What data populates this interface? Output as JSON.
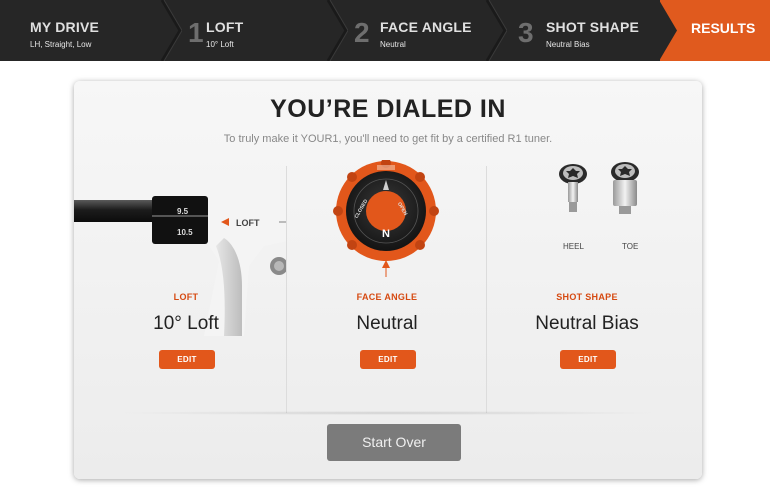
{
  "stepper": {
    "steps": [
      {
        "number": "",
        "title": "MY DRIVE",
        "sub": "LH, Straight, Low"
      },
      {
        "number": "1",
        "title": "LOFT",
        "sub": "10° Loft"
      },
      {
        "number": "2",
        "title": "FACE ANGLE",
        "sub": "Neutral"
      },
      {
        "number": "3",
        "title": "SHOT SHAPE",
        "sub": "Neutral Bias"
      }
    ],
    "results": "RESULTS"
  },
  "panel": {
    "headline": "YOU’RE DIALED IN",
    "subline": "To truly make it YOUR1, you'll need to get fit by a certified R1 tuner.",
    "loft": {
      "label": "LOFT",
      "value": "10° Loft",
      "edit": "EDIT",
      "ring_top": "9.5",
      "ring_bottom": "10.5",
      "sleeve_text": "LOFT"
    },
    "face_angle": {
      "label": "FACE ANGLE",
      "value": "Neutral",
      "edit": "EDIT",
      "dial_letter": "N",
      "dial_left": "CLOSED",
      "dial_right": "OPEN"
    },
    "shot_shape": {
      "label": "SHOT SHAPE",
      "value": "Neutral Bias",
      "edit": "EDIT",
      "heel": "HEEL",
      "toe": "TOE"
    },
    "start_over": "Start Over"
  },
  "colors": {
    "accent": "#e05a1e",
    "dark_bar": "#262626"
  }
}
